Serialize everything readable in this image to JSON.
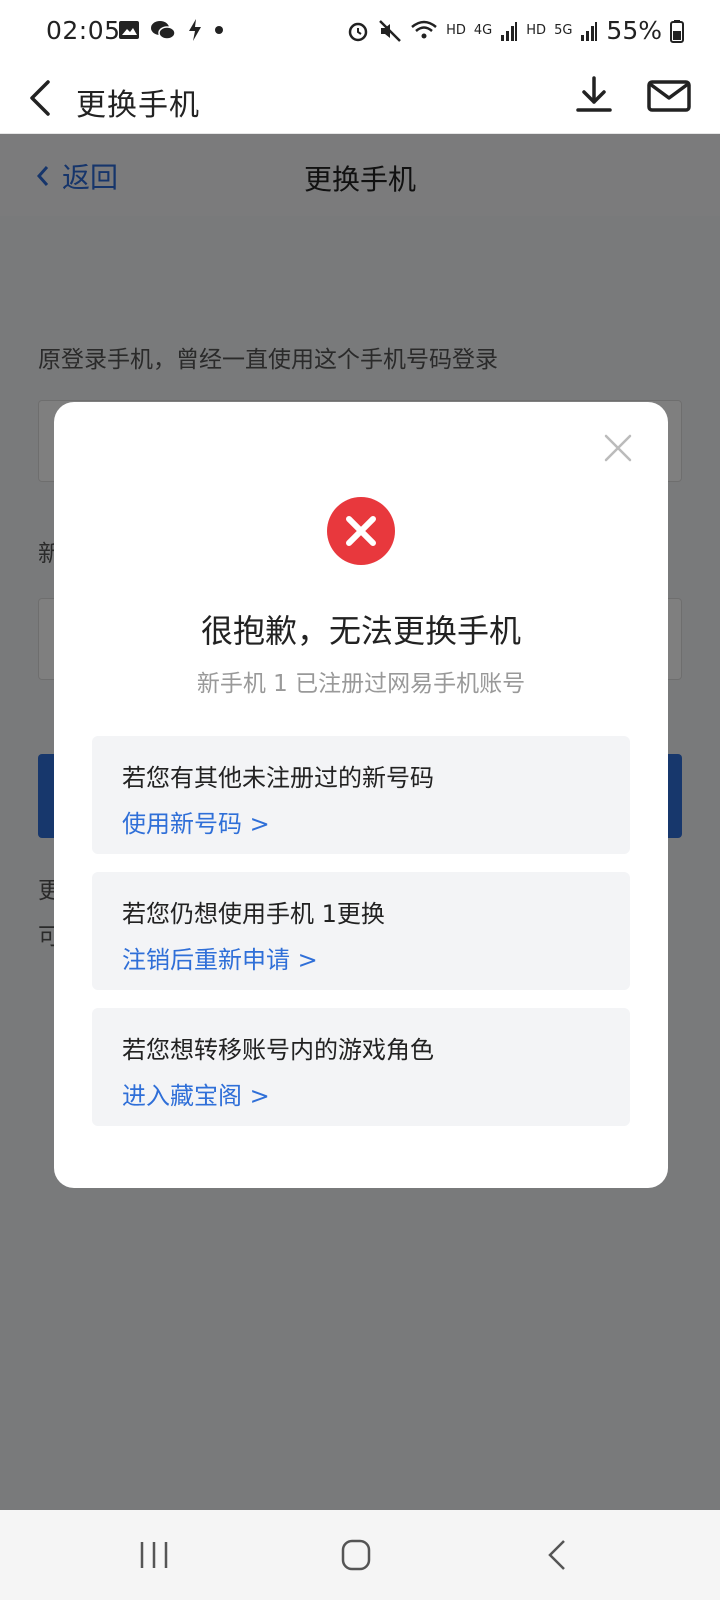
{
  "status_bar": {
    "time": "02:05",
    "battery": "55%",
    "net1": "HD",
    "net2": "4G",
    "net3": "HD",
    "net4": "5G",
    "icons": [
      "gallery-icon",
      "wechat-icon",
      "bolt-icon",
      "dot-icon",
      "alarm-icon",
      "mute-icon",
      "wifi-icon",
      "signal-icon",
      "battery-icon"
    ]
  },
  "app_header": {
    "title": "更换手机",
    "icons": [
      "back-arrow-icon",
      "download-icon",
      "mail-icon"
    ]
  },
  "web": {
    "back_label": "返回",
    "title": "更换手机",
    "old_phone_label": "原登录手机，曾经一直使用这个手机号码登录",
    "new_phone_label": "新",
    "note_line1": "更",
    "note_line2": "可"
  },
  "modal": {
    "title": "很抱歉，无法更换手机",
    "subtitle": "新手机 1       已注册过网易手机账号",
    "cards": [
      {
        "text": "若您有其他未注册过的新号码",
        "link": "使用新号码 >"
      },
      {
        "text": "若您仍想使用手机          1更换",
        "link": "注销后重新申请 >"
      },
      {
        "text": "若您想转移账号内的游戏角色",
        "link": "进入藏宝阁 >"
      }
    ]
  },
  "colors": {
    "accent": "#2f6fd8",
    "error": "#e8383d",
    "overlay": "rgba(0,0,0,0.5)"
  }
}
